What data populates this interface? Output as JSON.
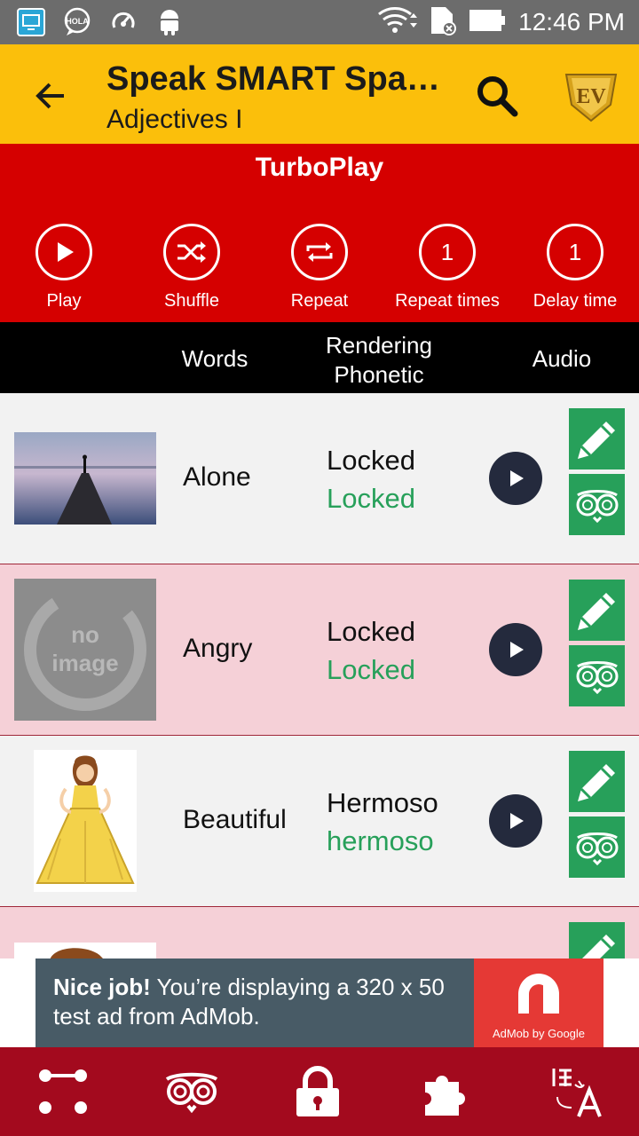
{
  "status_bar": {
    "time": "12:46 PM",
    "notification_icons": [
      "screencast-icon",
      "hola-chat-icon",
      "sync-speed-icon",
      "android-icon"
    ],
    "system_icons": [
      "wifi-icon",
      "sd-card-icon",
      "battery-icon"
    ],
    "hola_text": "HOLA"
  },
  "app_bar": {
    "title": "Speak SMART Spanish",
    "subtitle": "Adjectives I",
    "logo_text": "EV"
  },
  "turbo_play": {
    "title": "TurboPlay",
    "controls": [
      {
        "label": "Play",
        "icon": "play-icon",
        "value": ""
      },
      {
        "label": "Shuffle",
        "icon": "shuffle-icon",
        "value": ""
      },
      {
        "label": "Repeat",
        "icon": "repeat-icon",
        "value": ""
      },
      {
        "label": "Repeat times",
        "icon": "",
        "value": "1"
      },
      {
        "label": "Delay time",
        "icon": "",
        "value": "1"
      }
    ]
  },
  "columns": {
    "words": "Words",
    "rendering_phonetic": "Rendering\nPhonetic",
    "audio": "Audio"
  },
  "rows": [
    {
      "word": "Alone",
      "translation": "Locked",
      "phonetic": "Locked",
      "image": "pier-lake-photo"
    },
    {
      "word": "Angry",
      "translation": "Locked",
      "phonetic": "Locked",
      "image": "no-image-placeholder",
      "no_image_line1": "no",
      "no_image_line2": "image"
    },
    {
      "word": "Beautiful",
      "translation": "Hermoso",
      "phonetic": "hermoso",
      "image": "princess-illustration"
    }
  ],
  "ad": {
    "bold": "Nice job!",
    "text": " You’re displaying a 320 x 50 test ad from AdMob.",
    "caption": "AdMob by Google"
  },
  "bottom_nav": [
    "routes-icon",
    "owl-icon",
    "lock-icon",
    "puzzle-icon",
    "translate-icon"
  ],
  "colors": {
    "app_bar": "#fbbf0b",
    "turbo": "#d50000",
    "accent_green": "#27a05a",
    "bottom_nav": "#a30a1e",
    "row_pink": "#f5d0d7"
  }
}
